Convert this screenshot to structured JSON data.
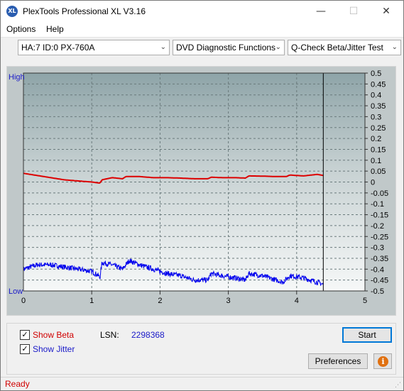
{
  "window": {
    "title": "PlexTools Professional XL V3.16",
    "icon_label": "XL",
    "minimize_glyph": "—",
    "maximize_glyph": "☐",
    "close_glyph": "✕"
  },
  "menu": {
    "options": "Options",
    "help": "Help"
  },
  "toolbar": {
    "drive": "HA:7 ID:0  PX-760A",
    "function": "DVD Diagnostic Functions",
    "test": "Q-Check Beta/Jitter Test",
    "arrow_glyph": "⌄"
  },
  "chart_data": {
    "type": "line",
    "x_ticks": [
      "0",
      "1",
      "2",
      "3",
      "4",
      "5"
    ],
    "xlim": [
      0,
      5
    ],
    "left_labels": {
      "top": "High",
      "bottom": "Low"
    },
    "right_ticks": [
      "0.5",
      "0.45",
      "0.4",
      "0.35",
      "0.3",
      "0.25",
      "0.2",
      "0.15",
      "0.1",
      "0.05",
      "0",
      "-0.05",
      "-0.1",
      "-0.15",
      "-0.2",
      "-0.25",
      "-0.3",
      "-0.35",
      "-0.4",
      "-0.45",
      "-0.5"
    ],
    "ylim": [
      -0.5,
      0.5
    ],
    "grid": true,
    "end_marker_x": 4.39,
    "series": [
      {
        "name": "Beta",
        "color": "#dd0000",
        "x": [
          0,
          0.2,
          0.4,
          0.6,
          0.8,
          1.0,
          1.12,
          1.15,
          1.3,
          1.45,
          1.5,
          1.7,
          1.9,
          2.1,
          2.3,
          2.5,
          2.7,
          2.75,
          2.9,
          3.1,
          3.25,
          3.3,
          3.5,
          3.7,
          3.85,
          3.9,
          4.1,
          4.3,
          4.39
        ],
        "values": [
          0.04,
          0.03,
          0.02,
          0.01,
          0.005,
          0.0,
          -0.005,
          0.01,
          0.02,
          0.015,
          0.025,
          0.025,
          0.02,
          0.02,
          0.018,
          0.015,
          0.015,
          0.022,
          0.02,
          0.02,
          0.018,
          0.028,
          0.027,
          0.025,
          0.025,
          0.032,
          0.028,
          0.035,
          0.03
        ]
      },
      {
        "name": "Jitter",
        "color": "#0000ee",
        "x": [
          0,
          0.2,
          0.4,
          0.6,
          0.8,
          1.0,
          1.1,
          1.12,
          1.15,
          1.3,
          1.45,
          1.55,
          1.7,
          1.9,
          2.1,
          2.3,
          2.5,
          2.7,
          2.75,
          2.9,
          3.1,
          3.25,
          3.3,
          3.5,
          3.7,
          3.8,
          3.9,
          4.1,
          4.3,
          4.39
        ],
        "values": [
          -0.4,
          -0.38,
          -0.38,
          -0.39,
          -0.4,
          -0.41,
          -0.43,
          -0.44,
          -0.37,
          -0.38,
          -0.4,
          -0.36,
          -0.38,
          -0.4,
          -0.42,
          -0.43,
          -0.45,
          -0.45,
          -0.42,
          -0.43,
          -0.44,
          -0.45,
          -0.42,
          -0.43,
          -0.45,
          -0.46,
          -0.43,
          -0.44,
          -0.46,
          -0.47
        ],
        "noise": 0.012
      }
    ]
  },
  "bottom": {
    "check_glyph": "✓",
    "show_beta": "Show Beta",
    "show_jitter": "Show Jitter",
    "lsn_label": "LSN:",
    "lsn_value": "2298368",
    "start": "Start",
    "preferences": "Preferences",
    "info_glyph": "i"
  },
  "status": {
    "text": "Ready",
    "grip_glyph": "⋰"
  }
}
